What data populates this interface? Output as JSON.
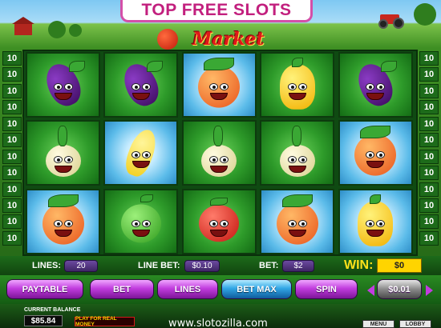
{
  "banner": {
    "title": "TOP FREE SLOTS"
  },
  "logo": {
    "text": "Market"
  },
  "line_markers": {
    "value": "10",
    "left_count": 12,
    "right_count": 12
  },
  "reels": {
    "rows": [
      [
        "eggplant",
        "eggplant",
        "orange",
        "pepper",
        "eggplant"
      ],
      [
        "onion",
        "banana",
        "onion",
        "onion",
        "orange"
      ],
      [
        "orange",
        "apple",
        "tomato",
        "orange",
        "pepper"
      ]
    ],
    "highlighted": [
      [
        0,
        2
      ],
      [
        1,
        1
      ],
      [
        1,
        4
      ],
      [
        2,
        0
      ],
      [
        2,
        3
      ],
      [
        2,
        4
      ]
    ]
  },
  "info": {
    "lines_label": "LINES:",
    "lines_value": "20",
    "line_bet_label": "LINE BET:",
    "line_bet_value": "$0.10",
    "bet_label": "BET:",
    "bet_value": "$2",
    "win_label": "WIN:",
    "win_value": "$0"
  },
  "buttons": {
    "paytable": "PAYTABLE",
    "bet": "BET",
    "lines": "LINES",
    "bet_max": "BET MAX",
    "spin": "SPIN",
    "coin_value": "$0.01"
  },
  "footer": {
    "balance_label": "CURRENT BALANCE",
    "balance_value": "$85.84",
    "play_real": "PLAY FOR REAL MONEY",
    "url": "www.slotozilla.com",
    "menu": "MENU",
    "lobby": "LOBBY"
  },
  "colors": {
    "banner_text": "#c21f7e",
    "button_purple": "#c23ddf",
    "button_blue": "#32a7e6",
    "win_box": "#ffd400",
    "cell_green": "#2e9b2a",
    "cell_blue": "#5bbbe9"
  }
}
